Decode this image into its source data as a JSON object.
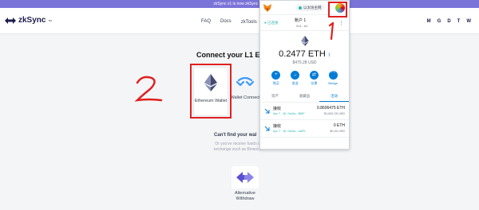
{
  "banner": {
    "text": "zkSync v1 is now zkSync Lite"
  },
  "nav": {
    "brand": "zkSync",
    "brand_mark": "TM",
    "links": [
      "FAQ",
      "Docs",
      "zkTools"
    ],
    "social": [
      "M",
      "G",
      "D",
      "T",
      "W"
    ]
  },
  "connect": {
    "title": "Connect your L1 ETH W",
    "ethereum_wallet": "Ethereum Wallet",
    "wallet_connect": "Wallet Connect",
    "cant_find": "Can't find your wal",
    "cant_find_sub": "Or you've receive funds on exchange such as Binance?",
    "alternative_withdraw": "Alternative Withdraw"
  },
  "annotations": {
    "step1": "1",
    "step2": "2",
    "color": "#e02020"
  },
  "metamask": {
    "network": "以太坊主网",
    "connected": "已连接",
    "account_name": "账户 1",
    "account_address": "0x4...b4",
    "balance": "0.2477 ETH",
    "balance_usd": "$475.28 USD",
    "actions": [
      {
        "label": "购买",
        "icon": "plus-icon"
      },
      {
        "label": "发送",
        "icon": "arrow-right-icon"
      },
      {
        "label": "交换",
        "icon": "swap-icon"
      },
      {
        "label": "Bridge",
        "icon": "bridge-icon"
      }
    ],
    "tabs": [
      "资产",
      "收藏品",
      "活动"
    ],
    "transactions": [
      {
        "title": "接收",
        "date": "Apr 7 · 从: 0xd4c...B6fF",
        "amount": "0.8606475 ETH",
        "usd": "$1,652.29 USD"
      },
      {
        "title": "接收",
        "date": "Apr 7 · 从: 0xd4c...4aFb",
        "amount": "0 ETH",
        "usd": "$0.00 USD"
      }
    ],
    "accent": "#037dd6"
  }
}
